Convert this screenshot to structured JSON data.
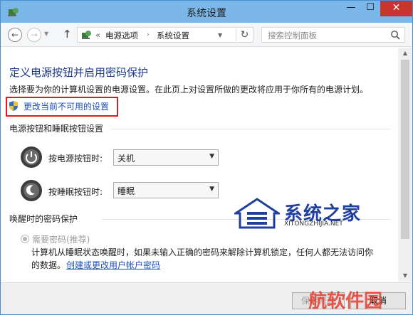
{
  "window": {
    "title": "系统设置"
  },
  "nav": {
    "breadcrumb_sep": "«",
    "crumb1": "电源选项",
    "crumb_sep": "›",
    "crumb2": "系统设置",
    "search_placeholder": "搜索控制面板"
  },
  "content": {
    "heading": "定义电源按钮并启用密码保护",
    "description": "选择要为你的计算机设置的电源设置。在此页上对设置所做的更改将应用于你所有的电源计划。",
    "change_link": "更改当前不可用的设置",
    "section_buttons": "电源按钮和睡眠按钮设置",
    "power_label": "按电源按钮时:",
    "power_value": "关机",
    "sleep_label": "按睡眠按钮时:",
    "sleep_value": "睡眠",
    "section_password": "唤醒时的密码保护",
    "require_password": "需要密码(推荐)",
    "pw_text_1": "计算机从睡眠状态唤醒时，如果未输入正确的密码来解除计算机锁定，任何人都无法访问你",
    "pw_text_2": "的数据。",
    "pw_link": "创建或更改用户帐户密码"
  },
  "footer": {
    "save": "保存修改",
    "cancel": "取消"
  },
  "watermark": {
    "main": "系统之家",
    "sub": "XITONGZHIJIA.NET",
    "bottom": "航软件园"
  },
  "colors": {
    "titlebar": "#7cb7ea",
    "link": "#1e4fb5",
    "heading": "#1e3a8a",
    "highlight": "#e0191e",
    "close": "#c7352b"
  }
}
